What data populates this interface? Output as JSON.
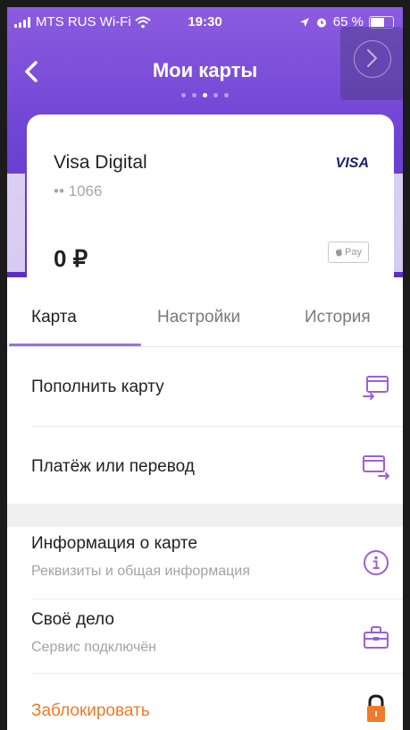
{
  "status_bar": {
    "carrier": "MTS RUS Wi-Fi",
    "time": "19:30",
    "battery": "65 %"
  },
  "nav": {
    "title": "Мои карты",
    "page_count": 5,
    "active_page": 3
  },
  "card": {
    "name": "Visa Digital",
    "number": "•• 1066",
    "brand": "VISA",
    "balance": "0 ₽",
    "wallet_badge": "Pay"
  },
  "tabs": [
    {
      "label": "Карта",
      "active": true
    },
    {
      "label": "Настройки",
      "active": false
    },
    {
      "label": "История",
      "active": false
    }
  ],
  "actions": {
    "top_up": {
      "title": "Пополнить карту",
      "icon": "card-topup-icon"
    },
    "payment": {
      "title": "Платёж или перевод",
      "icon": "card-transfer-icon"
    },
    "card_info": {
      "title": "Информация о карте",
      "subtitle": "Реквизиты и общая информация",
      "icon": "info-icon"
    },
    "business": {
      "title": "Своё дело",
      "subtitle": "Сервис подключён",
      "icon": "briefcase-icon"
    },
    "block": {
      "title": "Заблокировать",
      "icon": "lock-icon"
    }
  },
  "colors": {
    "header_purple": "#7044d4",
    "accent_purple": "#9c6fe0",
    "block_orange": "#f07a28"
  }
}
